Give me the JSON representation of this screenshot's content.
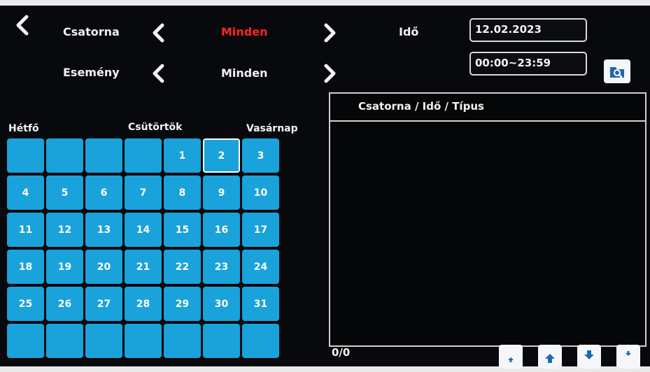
{
  "nav": {
    "back_icon": "chevron-left-icon"
  },
  "filters": {
    "channel_label": "Csatorna",
    "channel_value": "Minden",
    "event_label": "Esemény",
    "event_value": "Minden",
    "time_label": "Idő",
    "date_value": "12.02.2023",
    "time_range_value": "00:00~23:59"
  },
  "colors": {
    "accent": "#1aa2da",
    "highlight": "#ff2424",
    "background": "#07090d"
  },
  "calendar": {
    "weekday_labels": [
      "Hétfő",
      "Csütörtök",
      "Vasárnap"
    ],
    "selected_day": "2",
    "rows": [
      [
        "",
        "",
        "",
        "",
        "1",
        "2",
        "3"
      ],
      [
        "4",
        "5",
        "6",
        "7",
        "8",
        "9",
        "10"
      ],
      [
        "11",
        "12",
        "13",
        "14",
        "15",
        "16",
        "17"
      ],
      [
        "18",
        "19",
        "20",
        "21",
        "22",
        "23",
        "24"
      ],
      [
        "25",
        "26",
        "27",
        "28",
        "29",
        "30",
        "31"
      ],
      [
        "",
        "",
        "",
        "",
        "",
        "",
        ""
      ]
    ]
  },
  "results": {
    "header": "Csatorna / Idő / Típus",
    "count": "0/0"
  },
  "paging": {
    "buttons": [
      "first-page-icon",
      "prev-page-icon",
      "next-page-icon",
      "last-page-icon"
    ]
  }
}
